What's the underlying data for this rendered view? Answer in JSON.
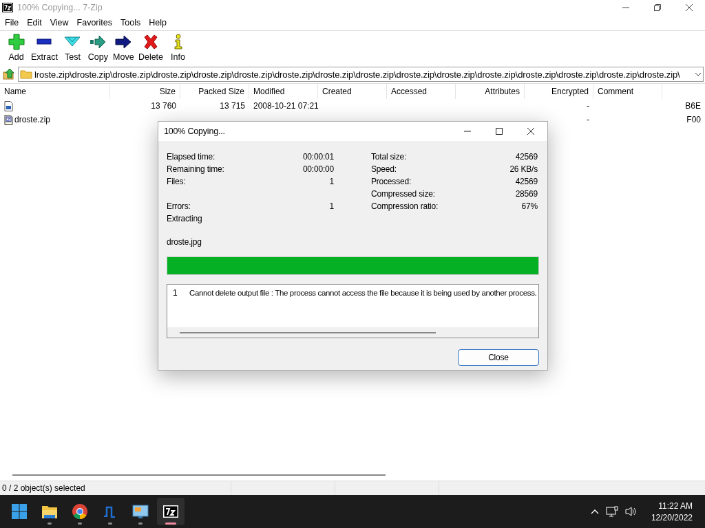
{
  "window": {
    "title": "100% Copying... 7-Zip"
  },
  "menu": [
    "File",
    "Edit",
    "View",
    "Favorites",
    "Tools",
    "Help"
  ],
  "toolbar": [
    {
      "label": "Add",
      "kind": "add"
    },
    {
      "label": "Extract",
      "kind": "extract"
    },
    {
      "label": "Test",
      "kind": "test"
    },
    {
      "label": "Copy",
      "kind": "copy"
    },
    {
      "label": "Move",
      "kind": "move"
    },
    {
      "label": "Delete",
      "kind": "delete"
    },
    {
      "label": "Info",
      "kind": "info"
    }
  ],
  "address": {
    "path": "lroste.zip\\droste.zip\\droste.zip\\droste.zip\\droste.zip\\droste.zip\\droste.zip\\droste.zip\\droste.zip\\droste.zip\\droste.zip\\droste.zip\\droste.zip\\droste.zip\\droste.zip\\droste.zip\\"
  },
  "file_list": {
    "columns": [
      "Name",
      "Size",
      "Packed Size",
      "Modified",
      "Created",
      "Accessed",
      "Attributes",
      "Encrypted",
      "Comment"
    ],
    "rows": [
      {
        "kind": "image",
        "size": "13 760",
        "packed_size": "13 715",
        "modified": "2008-10-21 07:21",
        "encrypted": "-",
        "column_10": "B6E"
      },
      {
        "kind": "zip",
        "name": "droste.zip",
        "encrypted": "-",
        "column_10": "F00"
      }
    ]
  },
  "status_bar": {
    "text": "0 / 2 object(s) selected"
  },
  "dialog": {
    "title": "100% Copying...",
    "left_stats": [
      {
        "label": "Elapsed time:",
        "value": "00:00:01"
      },
      {
        "label": "Remaining time:",
        "value": "00:00:00"
      },
      {
        "label": "Files:",
        "value": "1"
      },
      {
        "label": "Errors:",
        "value": "1"
      }
    ],
    "right_stats": [
      {
        "label": "Total size:",
        "value": "42569"
      },
      {
        "label": "Speed:",
        "value": "26 KB/s"
      },
      {
        "label": "Processed:",
        "value": "42569"
      },
      {
        "label": "Compressed size:",
        "value": "28569"
      },
      {
        "label": "Compression ratio:",
        "value": "67%"
      }
    ],
    "operation": "Extracting",
    "current_file": "droste.jpg",
    "progress": {
      "level": 1
    },
    "errors": [
      {
        "number": "1",
        "message": "Cannot delete output file : The process cannot access the file because it is being used by another process."
      }
    ],
    "button": "Close"
  },
  "taskbar": {
    "apps": [
      {
        "kind": "start",
        "selected": false
      },
      {
        "kind": "folder",
        "selected": false
      },
      {
        "kind": "browser",
        "selected": false
      },
      {
        "kind": "music",
        "selected": false
      },
      {
        "kind": "monitor",
        "selected": false
      },
      {
        "kind": "archiver",
        "selected": true
      }
    ],
    "time": "11:22 AM",
    "date": "12/20/2022"
  }
}
